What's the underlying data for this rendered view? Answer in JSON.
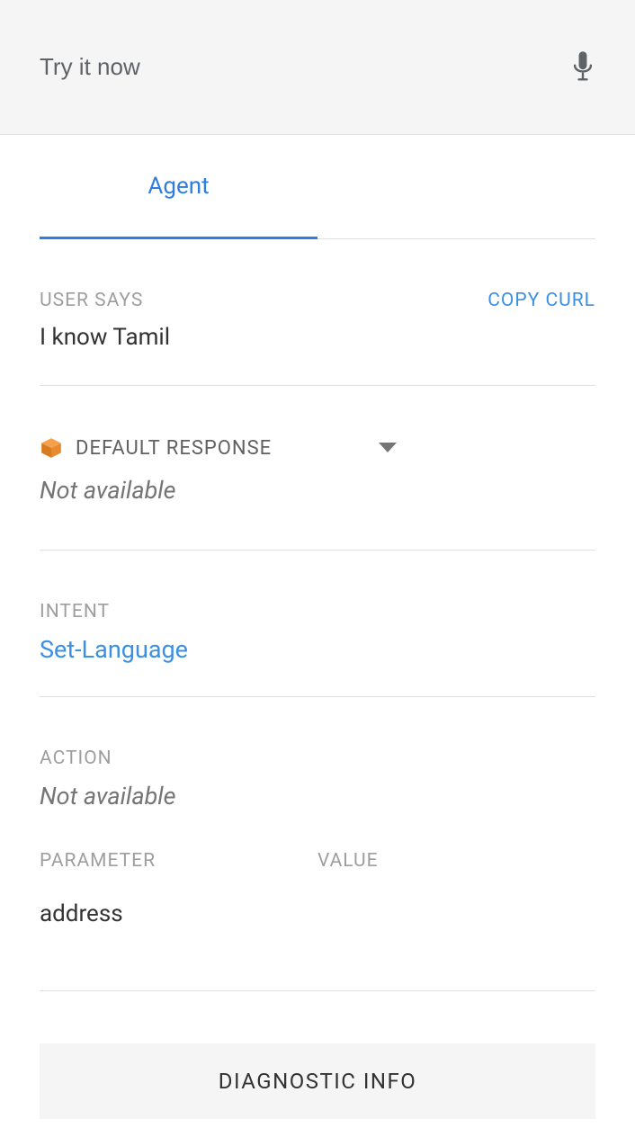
{
  "topbar": {
    "placeholder": "Try it now"
  },
  "tabs": {
    "agent": "Agent"
  },
  "userSays": {
    "label": "USER SAYS",
    "copy": "COPY CURL",
    "value": "I know Tamil"
  },
  "response": {
    "title": "DEFAULT RESPONSE",
    "value": "Not available"
  },
  "intent": {
    "label": "INTENT",
    "value": "Set-Language"
  },
  "action": {
    "label": "ACTION",
    "value": "Not available"
  },
  "params": {
    "headerParam": "PARAMETER",
    "headerValue": "VALUE",
    "rows": [
      {
        "param": "address",
        "value": ""
      }
    ]
  },
  "diag": {
    "button": "DIAGNOSTIC INFO"
  }
}
